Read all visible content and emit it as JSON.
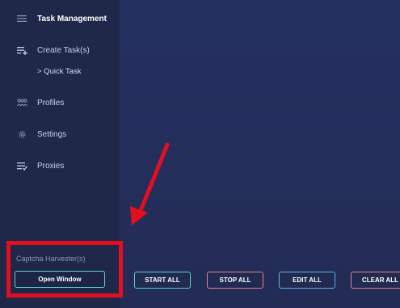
{
  "sidebar": {
    "items": [
      {
        "label": "Task Management",
        "icon": "list-icon"
      },
      {
        "label": "Create Task(s)",
        "icon": "add-list-icon"
      },
      {
        "label": "> Quick Task"
      },
      {
        "label": "Profiles",
        "icon": "profiles-icon"
      },
      {
        "label": "Settings",
        "icon": "gear-icon"
      },
      {
        "label": "Proxies",
        "icon": "proxies-icon"
      }
    ],
    "captcha_harvester_label": "Captcha Harvester(s)",
    "open_window_label": "Open Window"
  },
  "actions": {
    "start_all": "START ALL",
    "stop_all": "STOP ALL",
    "edit_all": "EDIT ALL",
    "clear_all": "CLEAR ALL"
  },
  "colors": {
    "background": "#222b4f",
    "sidebar": "#1f2849",
    "highlight": "#e10f1f",
    "start_border": "#5fd3c8",
    "stop_border": "#e8808a",
    "edit_border": "#58b6e8",
    "clear_border": "#e8808a"
  }
}
